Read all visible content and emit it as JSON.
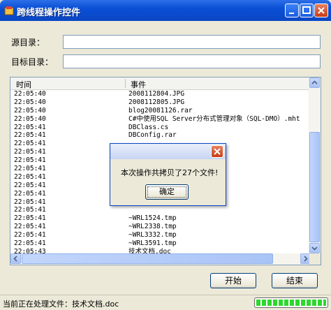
{
  "window": {
    "title": "跨线程操作控件",
    "controls": {
      "minimize": "_",
      "maximize": "□",
      "close": "✕"
    }
  },
  "form": {
    "source_label": "源目录：",
    "source_value": "",
    "target_label": "目标目录：",
    "target_value": ""
  },
  "log": {
    "columns": [
      "时间",
      "事件"
    ],
    "rows": [
      [
        "22:05:40",
        "2008112804.JPG"
      ],
      [
        "22:05:40",
        "2008112805.JPG"
      ],
      [
        "22:05:40",
        "blog20081126.rar"
      ],
      [
        "22:05:40",
        "C#中使用SQL Server分布式管理对象（SQL-DMO）.mht"
      ],
      [
        "22:05:41",
        "DBClass.cs"
      ],
      [
        "22:05:41",
        "DBConfig.rar"
      ],
      [
        "22:05:41",
        ""
      ],
      [
        "22:05:41",
        ""
      ],
      [
        "22:05:41",
        ""
      ],
      [
        "22:05:41",
        ""
      ],
      [
        "22:05:41",
        ""
      ],
      [
        "22:05:41",
        ""
      ],
      [
        "22:05:41",
        ""
      ],
      [
        "22:05:41",
        ""
      ],
      [
        "22:05:41",
        ""
      ],
      [
        "22:05:41",
        "~WRL1524.tmp"
      ],
      [
        "22:05:41",
        "~WRL2338.tmp"
      ],
      [
        "22:05:41",
        "~WRL3332.tmp"
      ],
      [
        "22:05:41",
        "~WRL3591.tmp"
      ],
      [
        "22:05:43",
        "技术文档.doc"
      ]
    ]
  },
  "buttons": {
    "start": "开始",
    "end": "结束"
  },
  "status": {
    "text": "当前正在处理文件：技术文档.doc",
    "progress": 1.0
  },
  "dialog": {
    "message": "本次操作共拷贝了27个文件!",
    "ok": "确定"
  }
}
